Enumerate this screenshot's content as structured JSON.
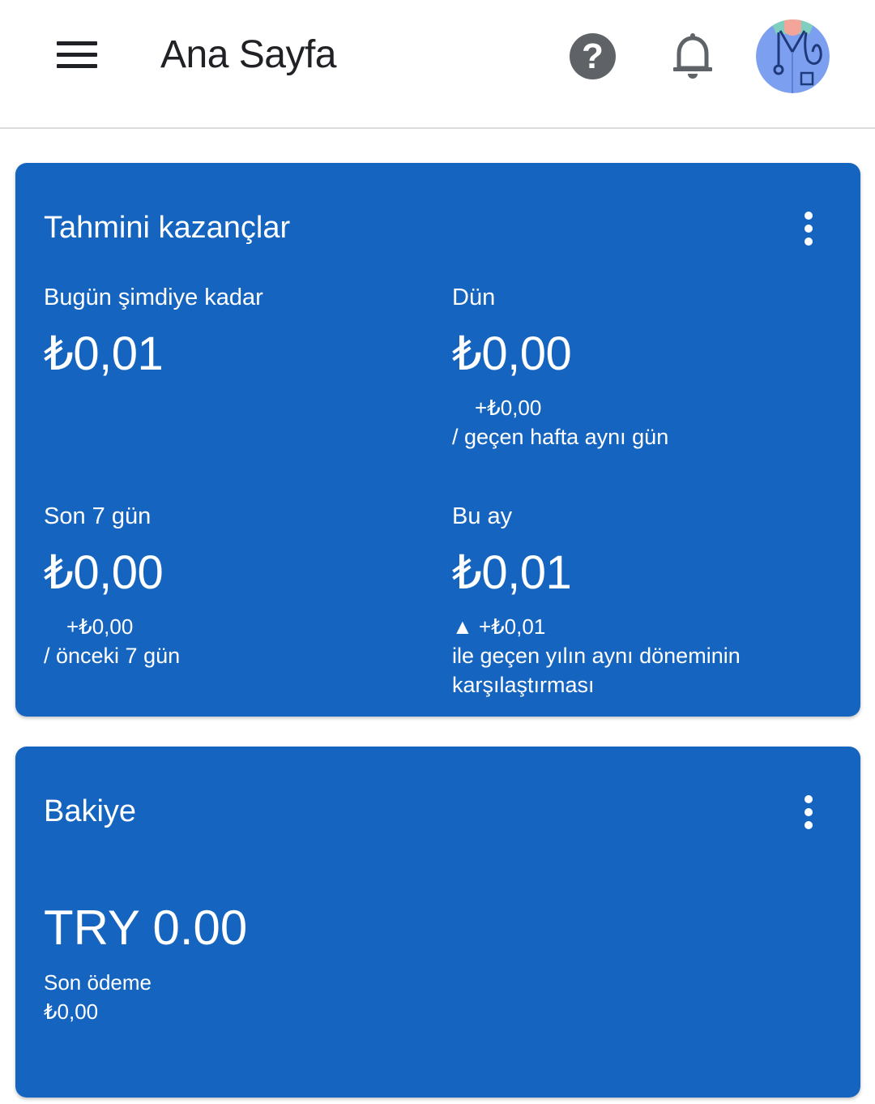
{
  "header": {
    "title": "Ana Sayfa",
    "menu_icon": "hamburger-menu-icon",
    "help_icon": "help-icon",
    "notifications_icon": "bell-icon",
    "avatar_icon": "doctor-avatar",
    "help_glyph": "?"
  },
  "earnings_card": {
    "title": "Tahmini kazançlar",
    "today": {
      "label": "Bugün şimdiye kadar",
      "value": "₺0,01"
    },
    "yesterday": {
      "label": "Dün",
      "value": "₺0,00",
      "change": "+₺0,00",
      "compare": "/ geçen hafta aynı gün"
    },
    "last7": {
      "label": "Son 7 gün",
      "value": "₺0,00",
      "change": "+₺0,00",
      "compare": "/ önceki 7 gün"
    },
    "this_month": {
      "label": "Bu ay",
      "value": "₺0,01",
      "change": "▲ +₺0,01",
      "compare_line1": "ile geçen yılın aynı döneminin",
      "compare_line2": "karşılaştırması"
    }
  },
  "balance_card": {
    "title": "Bakiye",
    "value": "TRY 0.00",
    "last_payment_label": "Son ödeme",
    "last_payment_value": "₺0,00"
  },
  "colors": {
    "card_background": "#1565c0",
    "text_on_card": "#ffffff",
    "header_text": "#202124",
    "icon_gray": "#5f6368"
  }
}
